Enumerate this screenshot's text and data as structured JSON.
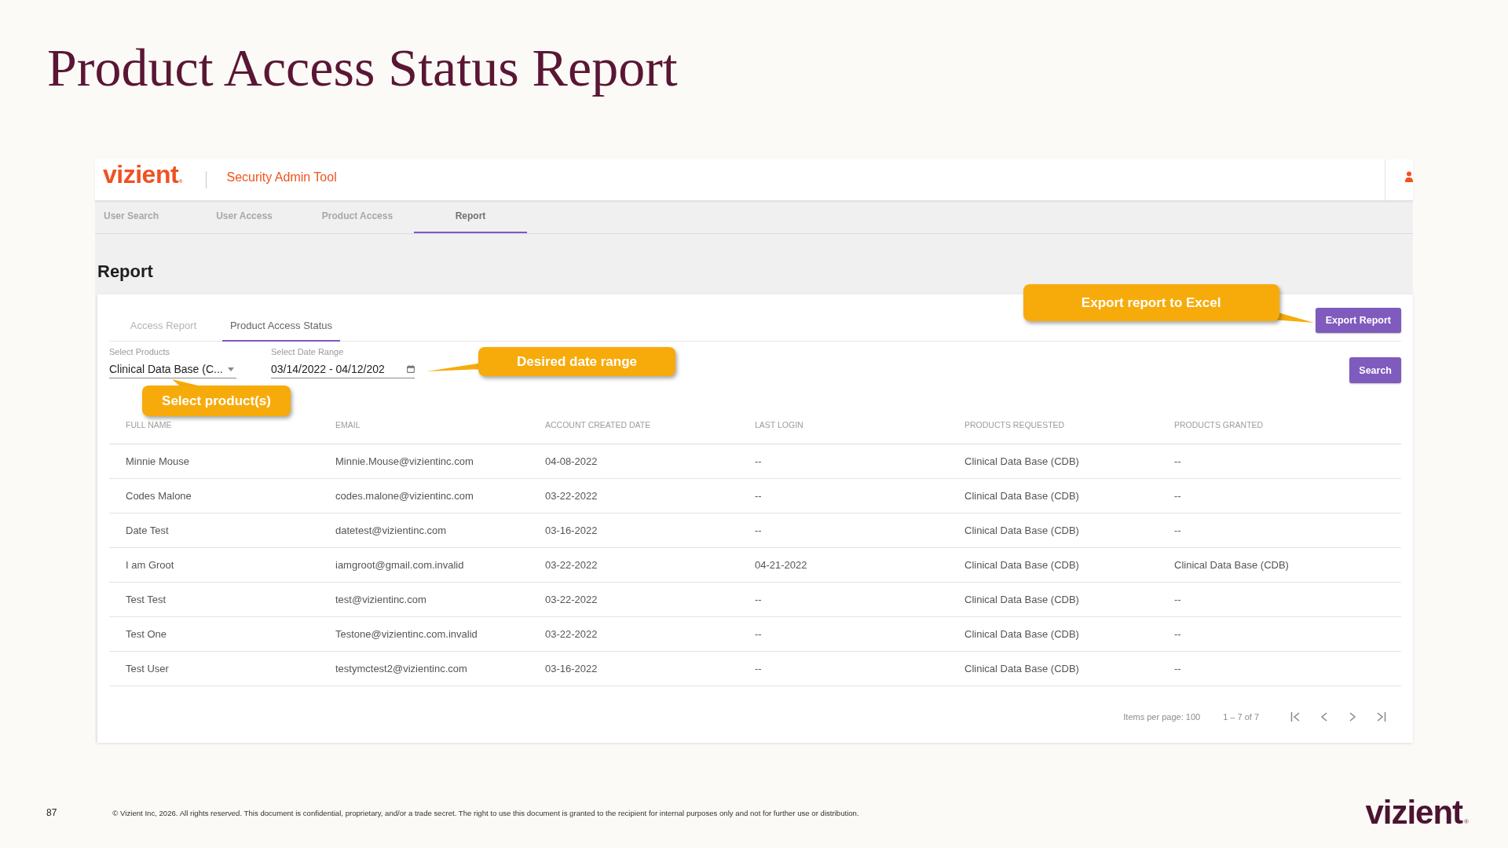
{
  "slide": {
    "title": "Product Access Status Report",
    "page_number": "87",
    "copyright": "© Vizient Inc, 2026. All rights reserved. This document is confidential, proprietary, and/or a trade secret. The right to use this document is granted to the recipient for internal purposes only and not for further use or distribution.",
    "footer_logo": {
      "text": "vizient",
      "mark": "®"
    }
  },
  "app": {
    "logo": {
      "text": "vizient",
      "mark": "®"
    },
    "title": "Security Admin Tool",
    "nav_tabs": [
      {
        "label": "User Search",
        "selected": false
      },
      {
        "label": "User Access",
        "selected": false
      },
      {
        "label": "Product Access",
        "selected": false
      },
      {
        "label": "Report",
        "selected": true
      }
    ],
    "page_heading": "Report",
    "report_tabs": [
      {
        "label": "Access Report",
        "selected": false
      },
      {
        "label": "Product Access Status",
        "selected": true
      }
    ],
    "export_button": {
      "label": "Export Report",
      "callout": "Export report to Excel"
    },
    "filters": [
      {
        "kind": "dropdown",
        "label": "Select Products",
        "value": "Clinical Data Base (C...",
        "callout": "Select product(s)"
      },
      {
        "kind": "date_range",
        "label": "Select Date Range",
        "value": "03/14/2022 - 04/12/202",
        "callout": "Desired date range"
      }
    ],
    "search_button": "Search",
    "table": {
      "columns": [
        "FULL NAME",
        "EMAIL",
        "ACCOUNT CREATED DATE",
        "LAST LOGIN",
        "PRODUCTS REQUESTED",
        "PRODUCTS GRANTED"
      ],
      "rows": [
        [
          "Minnie Mouse",
          "Minnie.Mouse@vizientinc.com",
          "04-08-2022",
          "--",
          "Clinical Data Base (CDB)",
          "--"
        ],
        [
          "Codes Malone",
          "codes.malone@vizientinc.com",
          "03-22-2022",
          "--",
          "Clinical Data Base (CDB)",
          "--"
        ],
        [
          "Date Test",
          "datetest@vizientinc.com",
          "03-16-2022",
          "--",
          "Clinical Data Base (CDB)",
          "--"
        ],
        [
          "I am Groot",
          "iamgroot@gmail.com.invalid",
          "03-22-2022",
          "04-21-2022",
          "Clinical Data Base (CDB)",
          "Clinical Data Base (CDB)"
        ],
        [
          "Test Test",
          "test@vizientinc.com",
          "03-22-2022",
          "--",
          "Clinical Data Base (CDB)",
          "--"
        ],
        [
          "Test One",
          "Testone@vizientinc.com.invalid",
          "03-22-2022",
          "--",
          "Clinical Data Base (CDB)",
          "--"
        ],
        [
          "Test User",
          "testymctest2@vizientinc.com",
          "03-16-2022",
          "--",
          "Clinical Data Base (CDB)",
          "--"
        ]
      ]
    },
    "pagination": {
      "items_per_page": "Items per page: 100",
      "range": "1 – 7 of 7"
    }
  }
}
